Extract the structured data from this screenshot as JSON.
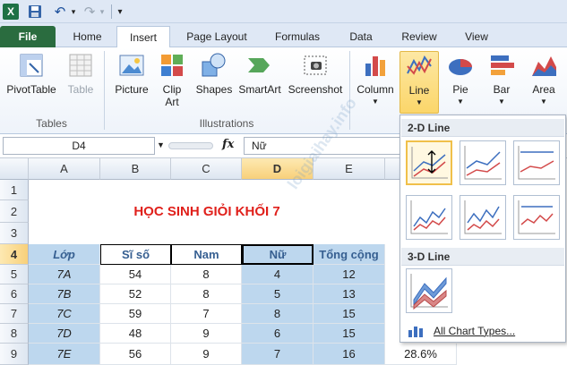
{
  "qat": {
    "excel_logo": "X",
    "more": "▾"
  },
  "tabs": [
    "File",
    "Home",
    "Insert",
    "Page Layout",
    "Formulas",
    "Data",
    "Review",
    "View"
  ],
  "ribbon": {
    "pivottable": "PivotTable",
    "table": "Table",
    "group_tables": "Tables",
    "picture": "Picture",
    "clipart_1": "Clip",
    "clipart_2": "Art",
    "shapes": "Shapes",
    "smartart": "SmartArt",
    "screenshot": "Screenshot",
    "group_illustrations": "Illustrations",
    "column": "Column",
    "line": "Line",
    "pie": "Pie",
    "bar": "Bar",
    "area": "Area"
  },
  "formula_bar": {
    "name_box": "D4",
    "fx": "fx",
    "value": "Nữ"
  },
  "columns": [
    "A",
    "B",
    "C",
    "D",
    "E"
  ],
  "rows": [
    "1",
    "2",
    "3",
    "4",
    "5",
    "6",
    "7",
    "8",
    "9"
  ],
  "sheet_title": "HỌC SINH GIỎI KHỐI 7",
  "table": {
    "headers": [
      "Lớp",
      "Sĩ số",
      "Nam",
      "Nữ",
      "Tổng cộng"
    ],
    "rows": [
      [
        "7A",
        "54",
        "8",
        "4",
        "12"
      ],
      [
        "7B",
        "52",
        "8",
        "5",
        "13"
      ],
      [
        "7C",
        "59",
        "7",
        "8",
        "15"
      ],
      [
        "7D",
        "48",
        "9",
        "6",
        "15"
      ],
      [
        "7E",
        "56",
        "9",
        "7",
        "16"
      ]
    ],
    "extra_f9": "28.6%"
  },
  "dropdown": {
    "section_2d": "2-D Line",
    "section_3d": "3-D Line",
    "all_chart_types": "All Chart Types..."
  },
  "watermark": "loigiaihay.info",
  "colors": {
    "accent": "#2a6c3f",
    "highlight": "#bdd7ee",
    "title": "#e0201b"
  }
}
